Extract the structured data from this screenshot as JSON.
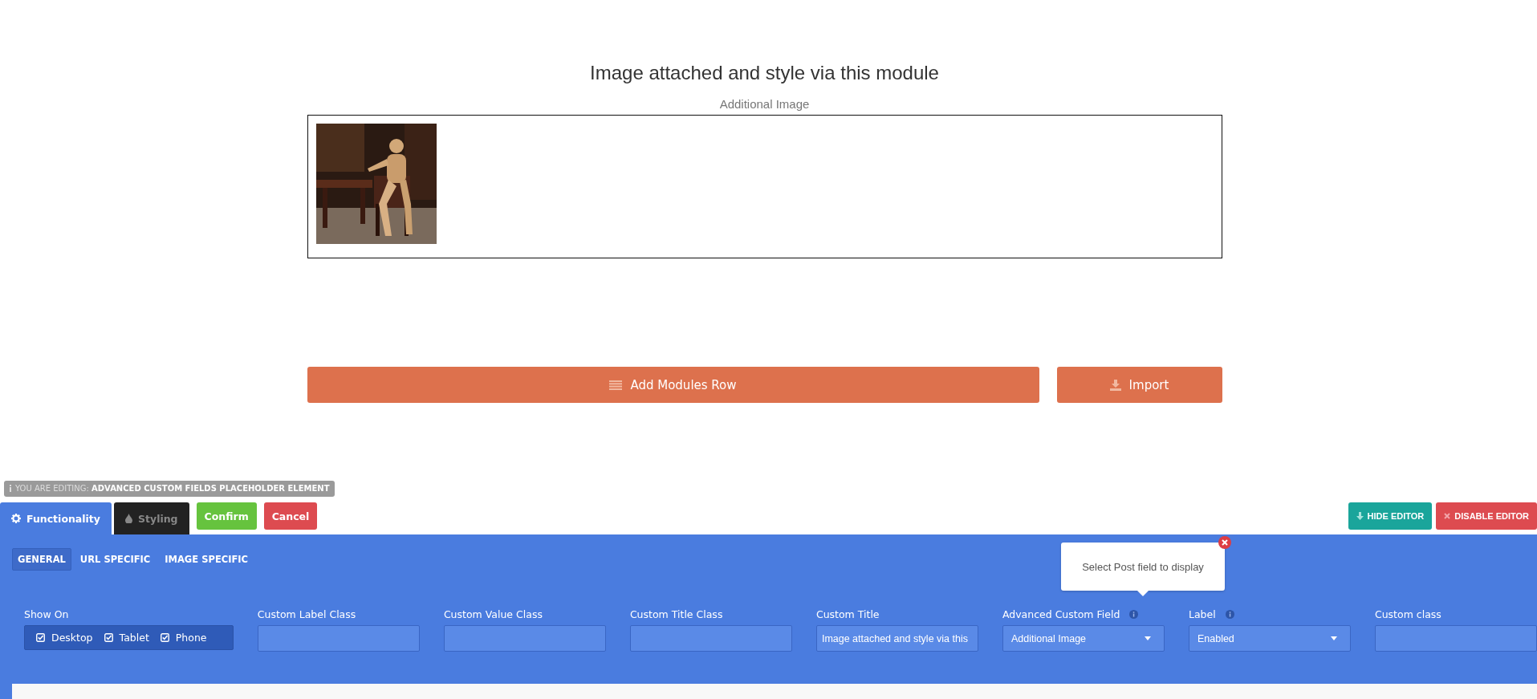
{
  "page_title": "Image attached and style via this module",
  "module": {
    "label": "Additional Image"
  },
  "actions": [
    {
      "kind": "add-row",
      "label": "Add Modules Row"
    },
    {
      "kind": "import",
      "label": "Import"
    }
  ],
  "editing_badge": {
    "prefix": "YOU ARE EDITING:",
    "element": "ADVANCED CUSTOM FIELDS PLACEHOLDER ELEMENT"
  },
  "editor_tabs": [
    {
      "kind": "functionality",
      "label": "Functionality",
      "selected": true
    },
    {
      "kind": "styling",
      "label": "Styling",
      "selected": false
    }
  ],
  "editor_buttons": [
    {
      "kind": "confirm",
      "label": "Confirm"
    },
    {
      "kind": "cancel",
      "label": "Cancel"
    }
  ],
  "editor_controls": [
    {
      "kind": "hide",
      "label": "HIDE EDITOR"
    },
    {
      "kind": "disable",
      "label": "DISABLE EDITOR"
    }
  ],
  "sub_tabs": [
    {
      "label": "GENERAL",
      "selected": true
    },
    {
      "label": "URL SPECIFIC",
      "selected": false
    },
    {
      "label": "IMAGE SPECIFIC",
      "selected": false
    }
  ],
  "tooltip": {
    "text": "Select Post field to display"
  },
  "fields": [
    {
      "kind": "checkgroup",
      "label": "Show On",
      "options": [
        {
          "label": "Desktop",
          "checked": true
        },
        {
          "label": "Tablet",
          "checked": true
        },
        {
          "label": "Phone",
          "checked": true
        }
      ]
    },
    {
      "kind": "text",
      "label": "Custom Label Class"
    },
    {
      "kind": "text",
      "label": "Custom Value Class"
    },
    {
      "kind": "text",
      "label": "Custom Title Class"
    },
    {
      "kind": "text",
      "label": "Custom Title",
      "value": "Image attached and style via this"
    },
    {
      "kind": "select",
      "label": "Advanced Custom Field",
      "info": true,
      "value": "Additional Image"
    },
    {
      "kind": "select",
      "label": "Label",
      "info": true,
      "value": "Enabled"
    },
    {
      "kind": "text",
      "label": "Custom class"
    }
  ]
}
